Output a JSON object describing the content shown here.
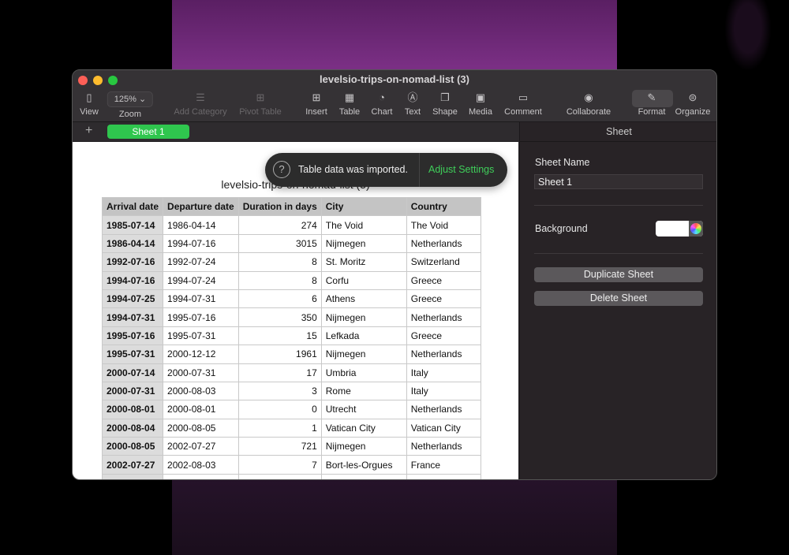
{
  "window": {
    "title": "levelsio-trips-on-nomad-list (3)"
  },
  "toolbar": {
    "view": "View",
    "zoom_value": "125%",
    "zoom": "Zoom",
    "add_category": "Add Category",
    "pivot_table": "Pivot Table",
    "insert": "Insert",
    "table": "Table",
    "chart": "Chart",
    "text": "Text",
    "shape": "Shape",
    "media": "Media",
    "comment": "Comment",
    "collaborate": "Collaborate",
    "format": "Format",
    "organize": "Organize"
  },
  "tabs": {
    "add": "+",
    "sheet1": "Sheet 1"
  },
  "table": {
    "title": "levelsio-trips-on-nomad-list (3)",
    "headers": [
      "Arrival date",
      "Departure date",
      "Duration in days",
      "City",
      "Country"
    ],
    "rows": [
      [
        "1985-07-14",
        "1986-04-14",
        "274",
        "The Void",
        "The Void"
      ],
      [
        "1986-04-14",
        "1994-07-16",
        "3015",
        "Nijmegen",
        "Netherlands"
      ],
      [
        "1992-07-16",
        "1992-07-24",
        "8",
        "St. Moritz",
        "Switzerland"
      ],
      [
        "1994-07-16",
        "1994-07-24",
        "8",
        "Corfu",
        "Greece"
      ],
      [
        "1994-07-25",
        "1994-07-31",
        "6",
        "Athens",
        "Greece"
      ],
      [
        "1994-07-31",
        "1995-07-16",
        "350",
        "Nijmegen",
        "Netherlands"
      ],
      [
        "1995-07-16",
        "1995-07-31",
        "15",
        "Lefkada",
        "Greece"
      ],
      [
        "1995-07-31",
        "2000-12-12",
        "1961",
        "Nijmegen",
        "Netherlands"
      ],
      [
        "2000-07-14",
        "2000-07-31",
        "17",
        "Umbria",
        "Italy"
      ],
      [
        "2000-07-31",
        "2000-08-03",
        "3",
        "Rome",
        "Italy"
      ],
      [
        "2000-08-01",
        "2000-08-01",
        "0",
        "Utrecht",
        "Netherlands"
      ],
      [
        "2000-08-04",
        "2000-08-05",
        "1",
        "Vatican City",
        "Vatican City"
      ],
      [
        "2000-08-05",
        "2002-07-27",
        "721",
        "Nijmegen",
        "Netherlands"
      ],
      [
        "2002-07-27",
        "2002-08-03",
        "7",
        "Bort-les-Orgues",
        "France"
      ]
    ]
  },
  "toast": {
    "message": "Table data was imported.",
    "action": "Adjust Settings"
  },
  "panel": {
    "header": "Sheet",
    "sheet_name_label": "Sheet Name",
    "sheet_name_value": "Sheet 1",
    "background_label": "Background",
    "duplicate": "Duplicate Sheet",
    "delete": "Delete Sheet"
  },
  "colors": {
    "accent": "#2fc64e",
    "toast_action": "#3fcf5a"
  }
}
